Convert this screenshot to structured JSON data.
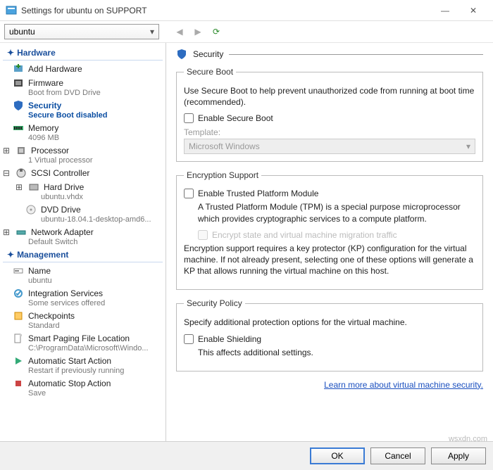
{
  "window": {
    "title": "Settings for ubuntu on SUPPORT",
    "minimize": "—",
    "close": "✕"
  },
  "toolbar": {
    "vm_name": "ubuntu",
    "back": "◀",
    "forward": "▶",
    "refresh": "⟳"
  },
  "sidebar": {
    "hardware_label": "Hardware",
    "management_label": "Management",
    "items": {
      "add_hardware": {
        "label": "Add Hardware"
      },
      "firmware": {
        "label": "Firmware",
        "sub": "Boot from DVD Drive"
      },
      "security": {
        "label": "Security",
        "sub": "Secure Boot disabled"
      },
      "memory": {
        "label": "Memory",
        "sub": "4096 MB"
      },
      "processor": {
        "label": "Processor",
        "sub": "1 Virtual processor"
      },
      "scsi": {
        "label": "SCSI Controller"
      },
      "hard_drive": {
        "label": "Hard Drive",
        "sub": "ubuntu.vhdx"
      },
      "dvd_drive": {
        "label": "DVD Drive",
        "sub": "ubuntu-18.04.1-desktop-amd6..."
      },
      "net": {
        "label": "Network Adapter",
        "sub": "Default Switch"
      },
      "name": {
        "label": "Name",
        "sub": "ubuntu"
      },
      "integration": {
        "label": "Integration Services",
        "sub": "Some services offered"
      },
      "checkpoints": {
        "label": "Checkpoints",
        "sub": "Standard"
      },
      "paging": {
        "label": "Smart Paging File Location",
        "sub": "C:\\ProgramData\\Microsoft\\Windo..."
      },
      "start": {
        "label": "Automatic Start Action",
        "sub": "Restart if previously running"
      },
      "stop": {
        "label": "Automatic Stop Action",
        "sub": "Save"
      }
    }
  },
  "content": {
    "heading": "Security",
    "secure_boot": {
      "legend": "Secure Boot",
      "desc": "Use Secure Boot to help prevent unauthorized code from running at boot time (recommended).",
      "checkbox": "Enable Secure Boot",
      "template_label": "Template:",
      "template_value": "Microsoft Windows"
    },
    "encryption": {
      "legend": "Encryption Support",
      "tpm_checkbox": "Enable Trusted Platform Module",
      "tpm_desc": "A Trusted Platform Module (TPM) is a special purpose microprocessor which provides cryptographic services to a compute platform.",
      "encrypt_state": "Encrypt state and virtual machine migration traffic",
      "kp_note": "Encryption support requires a key protector (KP) configuration for the virtual machine. If not already present, selecting one of these options will generate a KP that allows running the virtual machine on this host."
    },
    "policy": {
      "legend": "Security Policy",
      "desc": "Specify additional protection options for the virtual machine.",
      "shielding": "Enable Shielding",
      "note": "This affects additional settings."
    },
    "link": "Learn more about virtual machine security."
  },
  "footer": {
    "ok": "OK",
    "cancel": "Cancel",
    "apply": "Apply"
  },
  "watermark": "wsxdn.com"
}
